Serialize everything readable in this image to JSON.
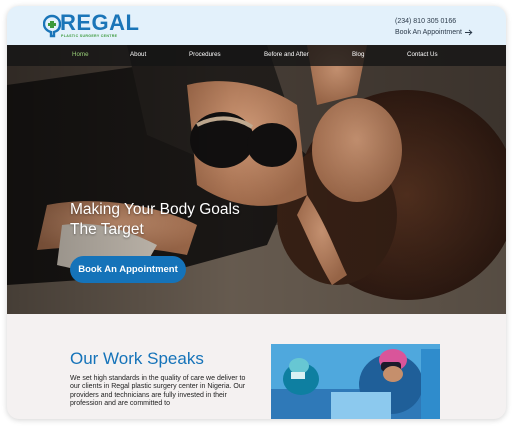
{
  "brand": {
    "name": "REGAL",
    "tagline": "PLASTIC SURGERY CENTRE"
  },
  "contact": {
    "phone": "(234) 810 305 0166",
    "cta": "Book An Appointment"
  },
  "nav": {
    "items": [
      "Home",
      "About",
      "Procedures",
      "Before and After",
      "Blog",
      "Contact Us"
    ],
    "active": "Home"
  },
  "hero": {
    "title": "Making Your Body Goals The Target",
    "button": "Book An Appointment",
    "slides": 3,
    "active_slide": 2
  },
  "section": {
    "title": "Our Work Speaks",
    "body": "We set high standards in the quality of care we deliver to our clients in Regal plastic surgery center in Nigeria. Our providers and technicians are fully invested in their profession and are committed to"
  },
  "colors": {
    "brand_blue": "#1573b9",
    "brand_green": "#3c9a3c",
    "nav_active": "#9bd07a",
    "header_bg": "#e3f1fb"
  }
}
